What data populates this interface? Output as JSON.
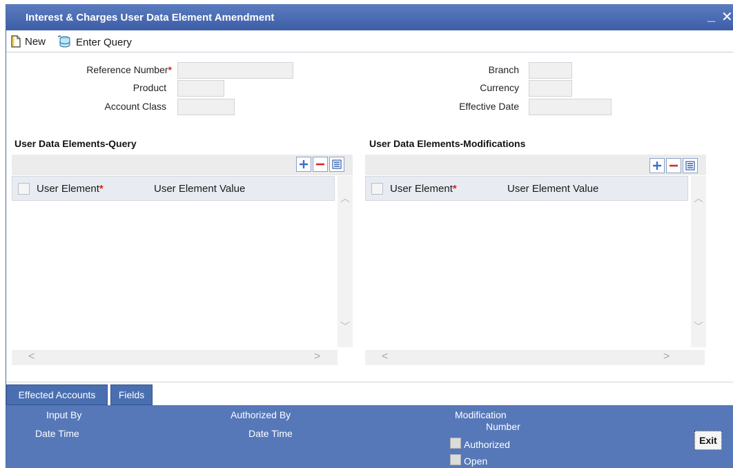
{
  "window": {
    "title": "Interest & Charges User Data Element Amendment",
    "minimize_label": "_",
    "close_label": "✕"
  },
  "toolbar": {
    "new_label": "New",
    "enter_query_label": "Enter Query"
  },
  "form": {
    "reference_number_label": "Reference Number",
    "product_label": "Product",
    "account_class_label": "Account Class",
    "branch_label": "Branch",
    "currency_label": "Currency",
    "effective_date_label": "Effective Date",
    "required_mark": "*"
  },
  "query_grid": {
    "title": "User Data Elements-Query",
    "col_user_element": "User Element",
    "col_user_element_value": "User Element Value"
  },
  "mod_grid": {
    "title": "User Data Elements-Modifications",
    "col_user_element": "User Element",
    "col_user_element_value": "User Element Value"
  },
  "bottom_tabs": {
    "effected_accounts_label": "Effected Accounts",
    "fields_label": "Fields"
  },
  "footer": {
    "input_by_label": "Input By",
    "date_time_label_1": "Date Time",
    "authorized_by_label": "Authorized By",
    "date_time_label_2": "Date Time",
    "modification_label": "Modification",
    "number_label": "Number",
    "authorized_label": "Authorized",
    "open_label": "Open",
    "exit_label": "Exit"
  },
  "colors": {
    "title_bar": "#4b6aa6",
    "footer_bg": "#5678b8",
    "required_star": "#e0201b",
    "grid_button_plus": "#3a6fd0",
    "grid_button_minus": "#d9252a"
  }
}
